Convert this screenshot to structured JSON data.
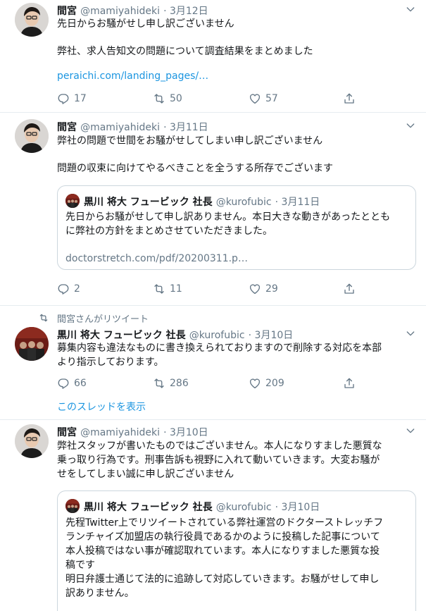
{
  "tweets": [
    {
      "name": "間宮",
      "handle": "@mamiyahideki",
      "date": "· 3月12日",
      "line1": "先日からお騒がせし申し訳ございません",
      "line2": "弊社、求人告知文の問題について調査結果をまとめました",
      "link": "peraichi.com/landing_pages/…",
      "replies": "17",
      "retweets": "50",
      "likes": "57"
    },
    {
      "name": "間宮",
      "handle": "@mamiyahideki",
      "date": "· 3月11日",
      "line1": "弊社の問題で世間をお騒がせしてしまい申し訳ございません",
      "line2": "問題の収束に向けてやるべきことを全うする所存でございます",
      "quote": {
        "name": "黒川 将大 フュービック 社長",
        "handle": "@kurofubic",
        "date": "· 3月11日",
        "text": "先日からお騒がせして申し訳ありません。本日大きな動きがあったととも\nに弊社の方針をまとめさせていただきました。",
        "link": "doctorstretch.com/pdf/20200311.p…"
      },
      "replies": "2",
      "retweets": "11",
      "likes": "29"
    },
    {
      "retweeted_by": "間宮さんがリツイート",
      "name": "黒川 将大 フュービック 社長",
      "handle": "@kurofubic",
      "date": "· 3月10日",
      "text": "募集内容も違法なものに書き換えられておりますので削除する対応を本部\nより指示しております。",
      "replies": "66",
      "retweets": "286",
      "likes": "209",
      "thread_link": "このスレッドを表示"
    },
    {
      "name": "間宮",
      "handle": "@mamiyahideki",
      "date": "· 3月10日",
      "text": "弊社スタッフが書いたものではございません。本人になりすました悪質な\n乗っ取り行為です。刑事告訴も視野に入れて動いていきます。大変お騒が\nせをしてしまい誠に申し訳ございません",
      "quote": {
        "name": "黒川 将大 フュービック 社長",
        "handle": "@kurofubic",
        "date": "· 3月10日",
        "text": "先程Twitter上でリツイートされている弊社運営のドクターストレッチフ\nランチャイズ加盟店の執行役員であるかのように投稿した記事について\n本人投稿ではない事が確認取れています。本人になりすました悪質な投\n稿です\n明日弁護士通じて法的に追跡して対応していきます。お騒がせして申し\n訳ありません。"
      }
    }
  ],
  "colors": {
    "link": "#1b95e0",
    "muted": "#657786",
    "text": "#14171a",
    "border": "#e6ecf0"
  }
}
